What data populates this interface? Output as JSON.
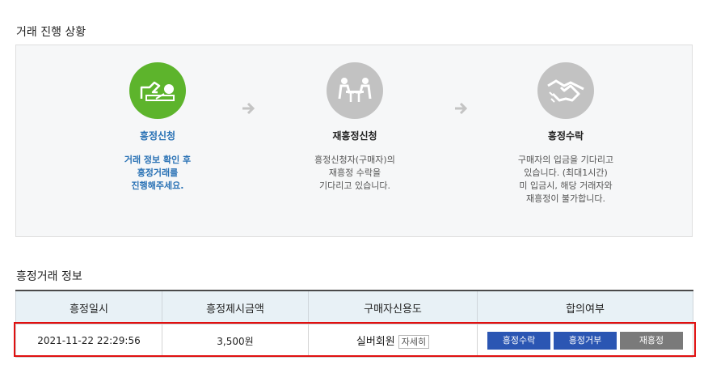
{
  "progress": {
    "title": "거래 진행 상황",
    "steps": [
      {
        "icon": "hand-signing-icon",
        "title": "흥정신청",
        "desc": "거래 정보 확인 후\n흥정거래를\n진행해주세요."
      },
      {
        "icon": "meeting-table-icon",
        "title": "재흥정신청",
        "desc": "흥정신청자(구매자)의\n재흥정 수락을\n기다리고 있습니다."
      },
      {
        "icon": "handshake-icon",
        "title": "흥정수락",
        "desc": "구매자의 입금을 기다리고\n있습니다. (최대1시간)\n미 입금시, 해당 거래자와\n재흥정이 불가합니다."
      }
    ]
  },
  "info": {
    "title": "흥정거래 정보",
    "headers": [
      "흥정일시",
      "흥정제시금액",
      "구매자신용도",
      "합의여부"
    ],
    "row": {
      "date": "2021-11-22 22:29:56",
      "amount": "3,500원",
      "credit": "실버회원",
      "detail_label": "자세히",
      "accept_label": "흥정수락",
      "reject_label": "흥정거부",
      "renegotiate_label": "재흥정"
    }
  },
  "colors": {
    "active": "#5db42c",
    "inactive": "#c2c2c2",
    "link": "#2a72b5",
    "button_blue": "#2b56b3",
    "button_gray": "#7a7a7a",
    "highlight": "#e01010"
  }
}
